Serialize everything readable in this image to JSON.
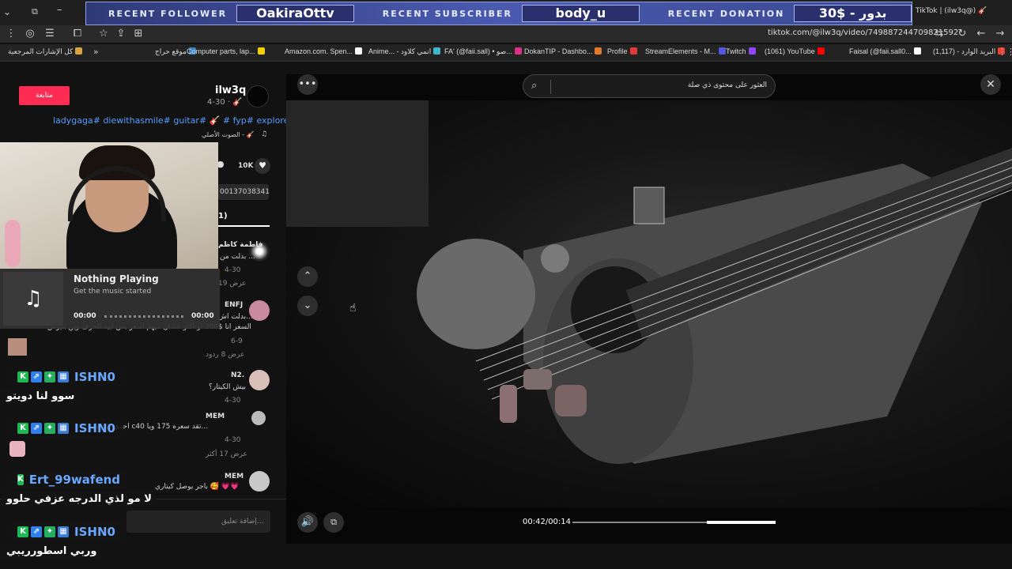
{
  "overlay": {
    "follower_label": "RECENT FOLLOWER",
    "follower_value": "OakiraOttv",
    "subscriber_label": "RECENT SUBSCRIBER",
    "subscriber_value": "body_u",
    "donation_label": "RECENT DONATION",
    "donation_value": "30$ - بدور"
  },
  "browser": {
    "tab_title": "TikTok | (ilw3q@) 🎸",
    "url": "tiktok.com/@ilw3q/video/749887244709821592"
  },
  "bookmarks": [
    {
      "label": "كل الإشارات المرجعية",
      "color": "#d9a441"
    },
    {
      "label": "موقع حراج",
      "color": "#3b82c4"
    },
    {
      "label": "Computer parts, lap...",
      "color": "#f0d000"
    },
    {
      "label": "Amazon.com. Spen...",
      "color": "#ffffff"
    },
    {
      "label": "Anime... - انمي كلاود",
      "color": "#3fb6c9"
    },
    {
      "label": "FA' (@faii.sall) • صو...",
      "color": "#d63384"
    },
    {
      "label": "DokanTIP - Dashbo...",
      "color": "#e07a2f"
    },
    {
      "label": "Profile",
      "color": "#e03a3a"
    },
    {
      "label": "StreamElements - M...",
      "color": "#5555dd"
    },
    {
      "label": "Twitch",
      "color": "#9146ff"
    },
    {
      "label": "(1061) YouTube",
      "color": "#ff0000"
    },
    {
      "label": "Faisal (@faii.sall0...",
      "color": "#ffffff"
    },
    {
      "label": "البريد الوارد - (1,117)",
      "color": "#ea4335"
    }
  ],
  "post": {
    "username": "ilw3q",
    "date": "4-30 · 🎸",
    "follow_label": "متابعة",
    "hashtags": "ladygaga# diewithasmile# guitar# 🎸 # fyp# explore#",
    "sound": "الصوت الأصلي - 🎸",
    "likes": "10K",
    "link_fragment": "00137038341",
    "comments_tab": "1)"
  },
  "search": {
    "placeholder": "العثور على محتوى ذي صلة"
  },
  "music_widget": {
    "title": "Nothing Playing",
    "subtitle": "Get the music started",
    "time_start": "00:00",
    "time_end": "00:00"
  },
  "comments": [
    {
      "name": "فاطمة كاظم",
      "text": "بدلت من ...",
      "meta": "4-30",
      "replies": "عرض 19"
    },
    {
      "name": "ENFJ",
      "text": "بدلت اش...",
      "text2": "السعر انا $300 او اكثر عشان ميهم اسعر بس ابيه الحرف وين بتيوس",
      "meta": "6-9",
      "replies": "عرض 8 ردود"
    },
    {
      "name": "N2.",
      "text": "بيش الكيتار؟",
      "meta": "4-30"
    },
    {
      "name": "MEM",
      "text": "احذي يلماها c40 تقد سعره 175 ويا...",
      "meta": "4-30",
      "replies": "عرض 17 أكثر"
    },
    {
      "name": "MEM",
      "text": "باجر يوصل كيتاري 🥰 💗💗",
      "meta": "4-30"
    }
  ],
  "comment_input_placeholder": "إضافة تعليق...",
  "chat": [
    {
      "name": "ISHN0",
      "name_color": "#6aa8ff",
      "message": "سوو لنا دويتو"
    },
    {
      "name": "ISHN0",
      "name_color": "#6aa8ff",
      "message": ""
    },
    {
      "name": "Ert_99wafend",
      "name_color": "#6aa8ff",
      "message": "لا مو لذي الدرجه عزفي حلوو"
    },
    {
      "name": "ISHN0",
      "name_color": "#6aa8ff",
      "message": "وربي اسطورريبي"
    }
  ],
  "player": {
    "time": "00:42/00:14",
    "progress": 0.66
  }
}
